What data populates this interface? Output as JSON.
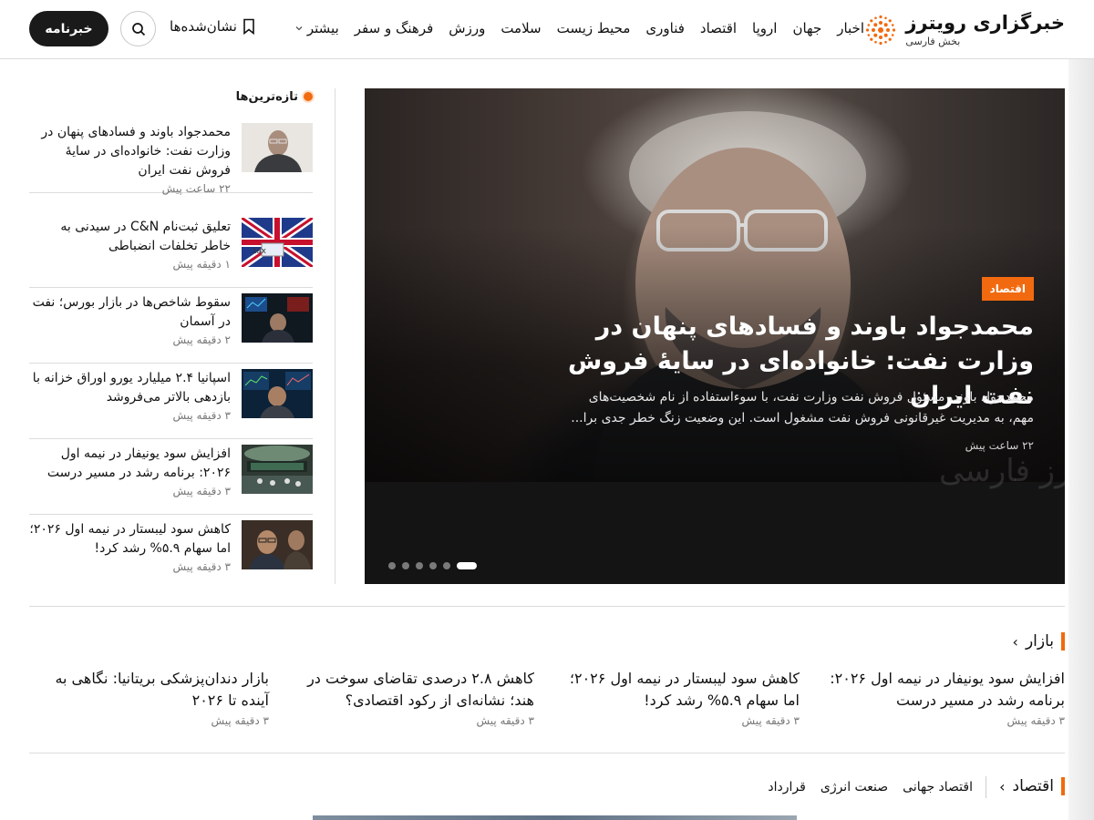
{
  "header": {
    "logo_title": "خبرگزاری رویترز",
    "logo_subtitle": "بخش فارسی",
    "nav": [
      "اخبار",
      "جهان",
      "اروپا",
      "اقتصاد",
      "فناوری",
      "محیط زیست",
      "سلامت",
      "ورزش",
      "فرهنگ و سفر"
    ],
    "more_label": "بیشتر",
    "bookmarks_label": "نشان‌شده‌ها",
    "newsletter_label": "خبرنامه",
    "accent": "#f26a0f"
  },
  "hero": {
    "tag": "اقتصاد",
    "title": "محمدجواد باوند و فسادهای پنهان در وزارت نفت: خانواده‌ای در سایهٔ فروش نفت ایران",
    "description": "محمدجواد باوند، مسئول فروش نفت وزارت نفت، با سوءاستفاده از نام شخصیت‌های مهم، به مدیریت غیرقانونی فروش نفت مشغول است. این وضعیت زنگ خطر جدی برا...",
    "time": "۲۲ ساعت پیش",
    "watermark": "رویترز فارسی",
    "slides_total": 6,
    "slide_active": 1
  },
  "latest": {
    "title": "تازه‌ترین‌ها",
    "items": [
      {
        "title": "محمدجواد باوند و فسادهای پنهان در وزارت نفت: خانواده‌ای در سایهٔ فروش نفت ایران",
        "time": "۲۲ ساعت پیش",
        "thumb_icon": "portrait-thumb-icon"
      },
      {
        "title": "تعلیق ثبت‌نام C&N در سیدنی به خاطر تخلفات انضباطی",
        "time": "۱ دقیقه پیش",
        "thumb_icon": "flag-tax-thumb-icon"
      },
      {
        "title": "سقوط شاخص‌ها در بازار بورس؛ نفت در آسمان",
        "time": "۲ دقیقه پیش",
        "thumb_icon": "trader-thumb-icon"
      },
      {
        "title": "اسپانیا ۲.۴ میلیارد یورو اوراق خزانه با بازدهی بالاتر می‌فروشد",
        "time": "۳ دقیقه پیش",
        "thumb_icon": "trader-screens-thumb-icon"
      },
      {
        "title": "افزایش سود یونیفار در نیمه اول ۲۰۲۶: برنامه رشد در مسیر درست",
        "time": "۳ دقیقه پیش",
        "thumb_icon": "trading-floor-thumb-icon"
      },
      {
        "title": "کاهش سود لیبستار در نیمه اول ۲۰۲۶؛ اما سهام ۵.۹% رشد کرد!",
        "time": "۳ دقیقه پیش",
        "thumb_icon": "traders-thumb-icon"
      }
    ]
  },
  "market": {
    "title": "بازار",
    "items": [
      {
        "title": "افزایش سود یونیفار در نیمه اول ۲۰۲۶: برنامه رشد در مسیر درست",
        "time": "۳ دقیقه پیش"
      },
      {
        "title": "کاهش سود لیبستار در نیمه اول ۲۰۲۶؛ اما سهام ۵.۹% رشد کرد!",
        "time": "۳ دقیقه پیش"
      },
      {
        "title": "کاهش ۲.۸ درصدی تقاضای سوخت در هند؛ نشانه‌ای از رکود اقتصادی؟",
        "time": "۳ دقیقه پیش"
      },
      {
        "title": "بازار دندان‌پزشکی بریتانیا: نگاهی به آینده تا ۲۰۲۶",
        "time": "۳ دقیقه پیش"
      }
    ]
  },
  "economy": {
    "title": "اقتصاد",
    "tabs": [
      "اقتصاد جهانی",
      "صنعت انرژی",
      "قرارداد"
    ]
  }
}
